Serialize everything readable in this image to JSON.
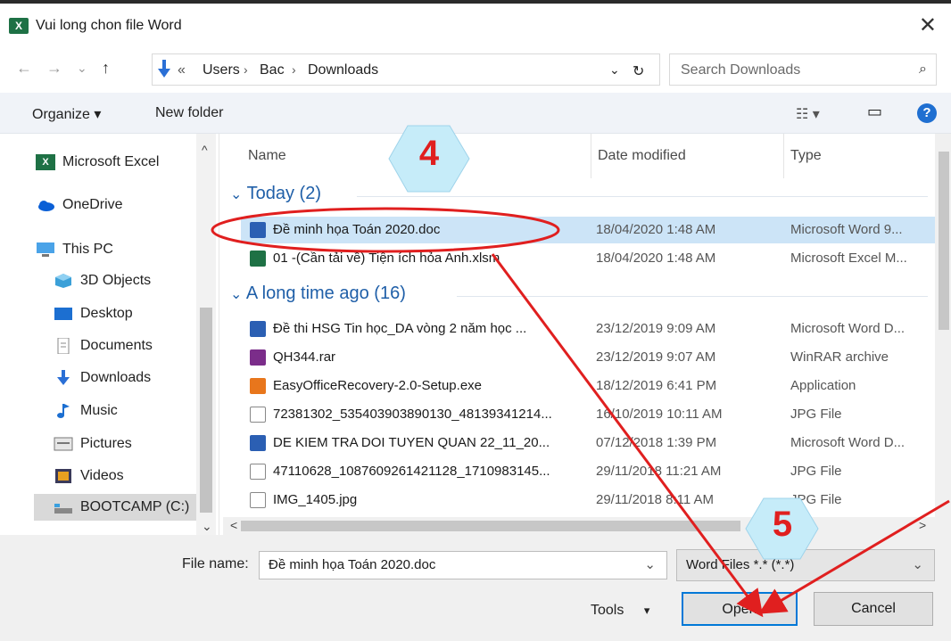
{
  "window": {
    "title": "Vui long chon file Word",
    "close_glyph": "✕",
    "app_icon_letter": "X"
  },
  "address": {
    "nav_back": "←",
    "nav_forward": "→",
    "nav_recent": "⌄",
    "nav_up": "↑",
    "overflow": "«",
    "crumbs": [
      "Users",
      "Bac",
      "Downloads"
    ],
    "separator": "›",
    "dropdown_glyph": "⌄",
    "refresh_glyph": "↻",
    "search_placeholder": "Search Downloads",
    "search_glyph": "⌕"
  },
  "toolbar": {
    "organize": "Organize ▾",
    "new_folder": "New folder",
    "view_glyph": "☷ ▾",
    "pane_glyph": "▭",
    "help_glyph": "?"
  },
  "sidebar": {
    "items": [
      {
        "label": "Microsoft Excel",
        "icon": "excel-icon"
      },
      {
        "label": "OneDrive",
        "icon": "cloud-icon"
      },
      {
        "label": "This PC",
        "icon": "computer-icon"
      },
      {
        "label": "3D Objects",
        "icon": "cube-icon"
      },
      {
        "label": "Desktop",
        "icon": "desktop-icon"
      },
      {
        "label": "Documents",
        "icon": "documents-icon"
      },
      {
        "label": "Downloads",
        "icon": "download-icon"
      },
      {
        "label": "Music",
        "icon": "music-icon"
      },
      {
        "label": "Pictures",
        "icon": "pictures-icon"
      },
      {
        "label": "Videos",
        "icon": "videos-icon"
      },
      {
        "label": "BOOTCAMP (C:)",
        "icon": "drive-icon"
      }
    ],
    "scroll_up": "^",
    "scroll_down": "⌄"
  },
  "list": {
    "columns": {
      "name": "Name",
      "date": "Date modified",
      "type": "Type"
    },
    "groups": [
      {
        "label": "Today (2)",
        "chevron": "⌄"
      },
      {
        "label": "A long time ago (16)",
        "chevron": "⌄"
      }
    ],
    "rows": [
      {
        "name": "Đề minh họa Toán 2020.doc",
        "date": "18/04/2020 1:48 AM",
        "type": "Microsoft Word 9...",
        "icon": "word-file-icon",
        "selected": true
      },
      {
        "name": "01 -(Cần tải về) Tiện ích hỏa Anh.xlsm",
        "date": "18/04/2020 1:48 AM",
        "type": "Microsoft Excel M...",
        "icon": "excel-file-icon"
      },
      {
        "name": "Đề thi HSG Tin học_DA vòng 2 năm học ...",
        "date": "23/12/2019 9:09 AM",
        "type": "Microsoft Word D...",
        "icon": "word-file-icon"
      },
      {
        "name": "QH344.rar",
        "date": "23/12/2019 9:07 AM",
        "type": "WinRAR archive",
        "icon": "rar-file-icon"
      },
      {
        "name": "EasyOfficeRecovery-2.0-Setup.exe",
        "date": "18/12/2019 6:41 PM",
        "type": "Application",
        "icon": "exe-file-icon"
      },
      {
        "name": "72381302_535403903890130_48139341214...",
        "date": "16/10/2019 10:11 AM",
        "type": "JPG File",
        "icon": "image-file-icon"
      },
      {
        "name": "DE KIEM TRA DOI TUYEN QUAN 22_11_20...",
        "date": "07/12/2018 1:39 PM",
        "type": "Microsoft Word D...",
        "icon": "word-file-icon"
      },
      {
        "name": "47110628_1087609261421128_1710983145...",
        "date": "29/11/2018 11:21 AM",
        "type": "JPG File",
        "icon": "image-file-icon"
      },
      {
        "name": "IMG_1405.jpg",
        "date": "29/11/2018 8:11 AM",
        "type": "JPG File",
        "icon": "image-file-icon"
      }
    ],
    "hscroll_left": "<",
    "hscroll_right": ">"
  },
  "footer": {
    "file_name_label": "File name:",
    "file_name_value": "Đề minh họa Toán 2020.doc",
    "filter_value": "Word Files *.* (*.*)",
    "dropdown_glyph": "⌄",
    "tools": "Tools",
    "tools_glyph": "▾",
    "open": "Open",
    "cancel": "Cancel"
  },
  "annotations": {
    "step_a": "4",
    "step_b": "5"
  },
  "colors": {
    "accent": "#0078d7",
    "selection": "#cce4f7",
    "annotation_red": "#e01f1f",
    "badge_fill": "#c6ecf9"
  }
}
